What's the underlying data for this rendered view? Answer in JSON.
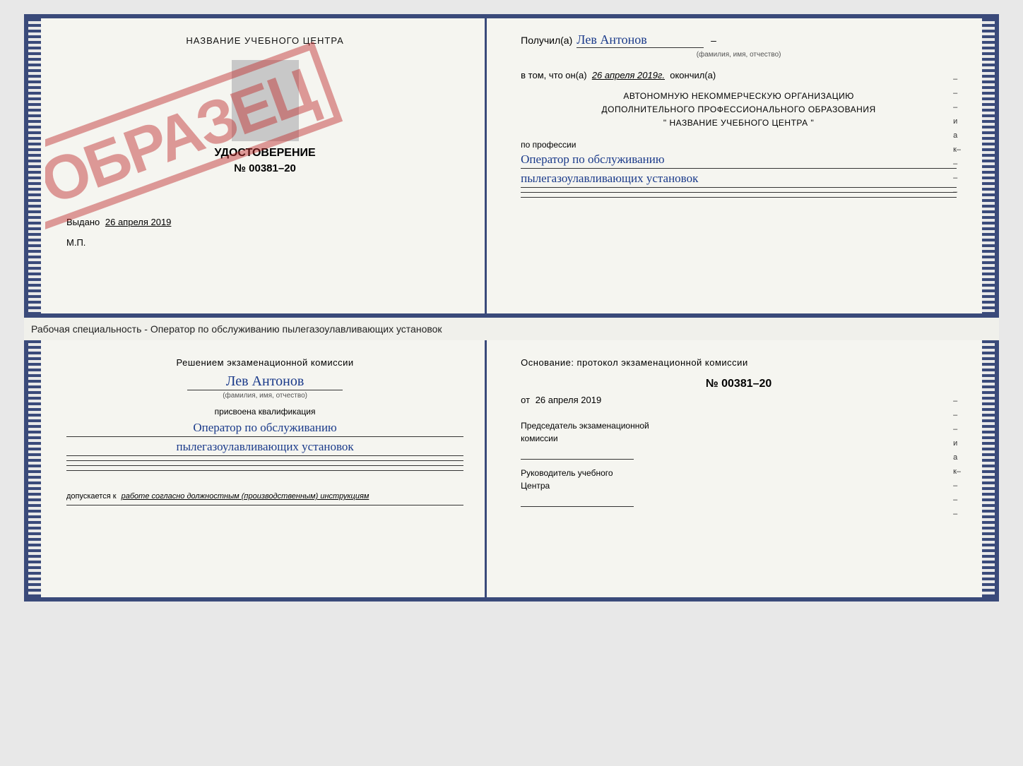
{
  "top_cert": {
    "left": {
      "center_title": "НАЗВАНИЕ УЧЕБНОГО ЦЕНТРА",
      "cert_title": "УДОСТОВЕРЕНИЕ",
      "cert_number": "№ 00381–20",
      "issued_label": "Выдано",
      "issued_date": "26 апреля 2019",
      "mp_label": "М.П.",
      "stamp_text": "ОБРАЗЕЦ"
    },
    "right": {
      "received_prefix": "Получил(а)",
      "received_name": "Лев Антонов",
      "name_caption": "(фамилия, имя, отчество)",
      "in_that_prefix": "в том, что он(а)",
      "in_that_date": "26 апреля 2019г.",
      "finished_label": "окончил(а)",
      "org_line1": "АВТОНОМНУЮ НЕКОММЕРЧЕСКУЮ ОРГАНИЗАЦИЮ",
      "org_line2": "ДОПОЛНИТЕЛЬНОГО ПРОФЕССИОНАЛЬНОГО ОБРАЗОВАНИЯ",
      "org_line3": "\"   НАЗВАНИЕ УЧЕБНОГО ЦЕНТРА   \"",
      "profession_label": "по профессии",
      "profession_line1": "Оператор по обслуживанию",
      "profession_line2": "пылегазоулавливающих установок",
      "side_chars": [
        "–",
        "–",
        "–",
        "и",
        "а",
        "к–",
        "–",
        "–",
        "–"
      ]
    }
  },
  "divider": {
    "text": "Рабочая специальность - Оператор по обслуживанию пылегазоулавливающих установок"
  },
  "bottom_cert": {
    "left": {
      "decision_label": "Решением экзаменационной комиссии",
      "name_handwritten": "Лев Антонов",
      "name_caption": "(фамилия, имя, отчество)",
      "assigned_label": "присвоена квалификация",
      "qualification_line1": "Оператор по обслуживанию",
      "qualification_line2": "пылегазоулавливающих установок",
      "allowed_prefix": "допускается к",
      "allowed_text": "работе согласно должностным (производственным) инструкциям"
    },
    "right": {
      "basis_label": "Основание: протокол экзаменационной комиссии",
      "protocol_number": "№  00381–20",
      "protocol_date_prefix": "от",
      "protocol_date": "26 апреля 2019",
      "chairman_line1": "Председатель экзаменационной",
      "chairman_line2": "комиссии",
      "head_line1": "Руководитель учебного",
      "head_line2": "Центра",
      "side_chars": [
        "–",
        "–",
        "–",
        "и",
        "а",
        "к–",
        "–",
        "–",
        "–"
      ]
    }
  }
}
